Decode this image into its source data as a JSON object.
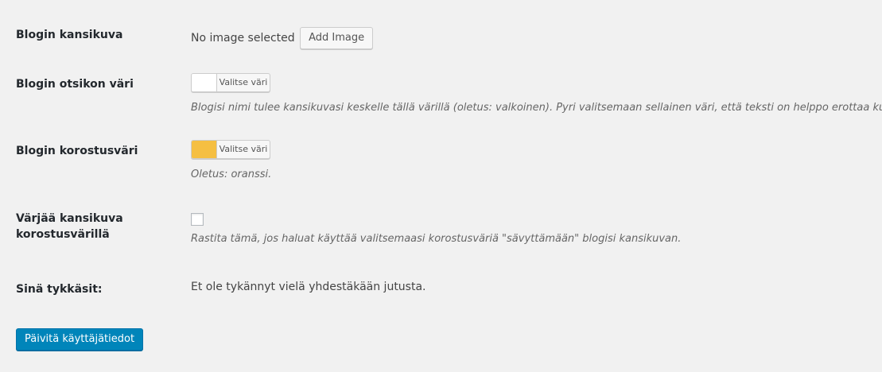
{
  "cover_image": {
    "label": "Blogin kansikuva",
    "status": "No image selected",
    "button": "Add Image"
  },
  "title_color": {
    "label": "Blogin otsikon väri",
    "button": "Valitse väri",
    "swatch_color": "#ffffff",
    "description": "Blogisi nimi tulee kansikuvasi keskelle tällä värillä (oletus: valkoinen). Pyri valitsemaan sellainen väri, että teksti on helppo erottaa kuvasta."
  },
  "accent_color": {
    "label": "Blogin korostusväri",
    "button": "Valitse väri",
    "swatch_color": "#f5bf42",
    "description": "Oletus: oranssi."
  },
  "tint_cover": {
    "label_line1": "Värjää kansikuva",
    "label_line2": "korostusvärillä",
    "checked": false,
    "description": "Rastita tämä, jos haluat käyttää valitsemaasi korostusväriä \"sävyttämään\" blogisi kansikuvan."
  },
  "likes": {
    "label": "Sinä tykkäsit:",
    "value": "Et ole tykännyt vielä yhdestäkään jutusta."
  },
  "submit": {
    "label": "Päivitä käyttäjätiedot"
  }
}
